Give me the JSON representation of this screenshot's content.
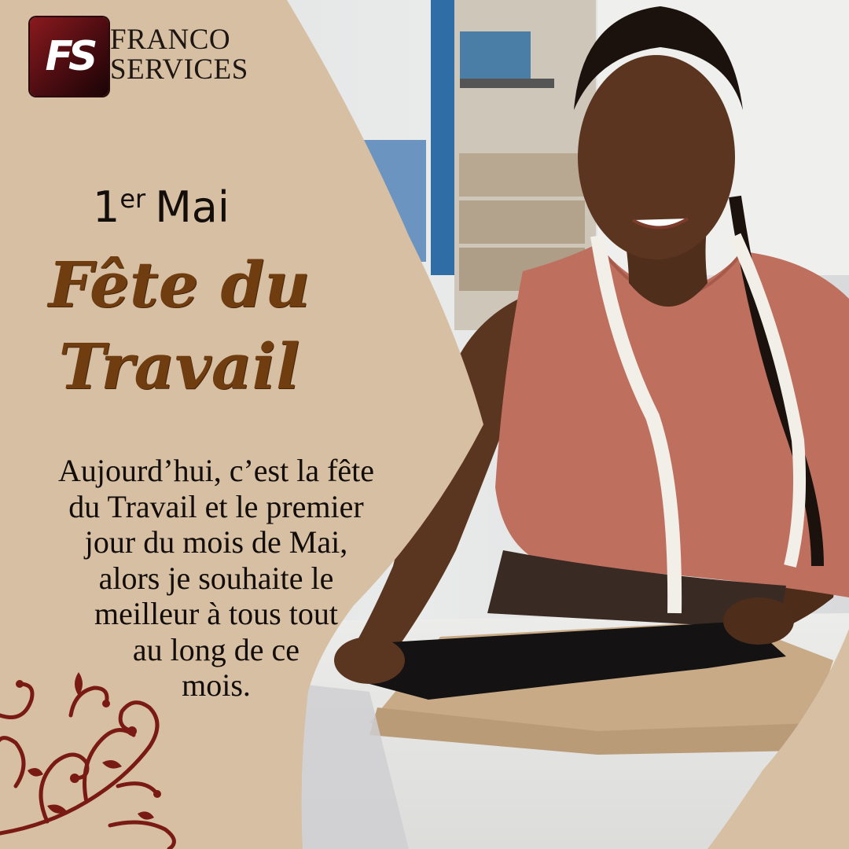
{
  "brand": {
    "line1": "FRANCO",
    "line2": "SERVICES",
    "logo_text": "FS"
  },
  "heading": {
    "day": "1",
    "ordinal": "er",
    "month": "Mai"
  },
  "title": {
    "line1": "Fête du",
    "line2": "Travail"
  },
  "message": [
    "Aujourd’hui, c’est la fête",
    "du Travail et le premier",
    "jour du mois de Mai,",
    "alors je souhaite le",
    "meilleur à tous tout",
    "au long de ce",
    "mois."
  ],
  "colors": {
    "background_tan": "#d7bfa3",
    "title_brown": "#6f3d10",
    "swirl_red": "#7a1a14",
    "logo_red": "#8a1a1e"
  },
  "icons": {
    "logo": "fs-logo-icon",
    "ornament": "floral-swirl-icon"
  }
}
